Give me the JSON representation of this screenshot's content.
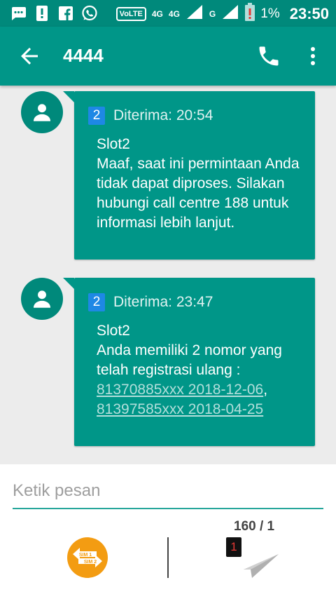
{
  "status_bar": {
    "network_labels": [
      "4G",
      "4G",
      "G"
    ],
    "volte": "VoLTE",
    "battery": "1%",
    "time": "23:50",
    "icons": [
      "message-icon",
      "alert-icon",
      "facebook-icon",
      "whatsapp-icon",
      "signal-icon",
      "battery-low-icon"
    ]
  },
  "toolbar": {
    "title": "4444",
    "back_icon": "arrow-back-icon",
    "call_icon": "phone-icon",
    "menu_icon": "more-vert-icon"
  },
  "messages": [
    {
      "sim": "2",
      "received_label": "Diterima: 20:54",
      "lines": [
        "Slot2",
        "Maaf, saat ini permintaan Anda tidak dapat diproses. Silakan hubungi call centre 188 untuk informasi lebih lanjut."
      ]
    },
    {
      "sim": "2",
      "received_label": "Diterima: 23:47",
      "slot": "Slot2",
      "text_prefix": "Anda memiliki 2 nomor yang telah registrasi ulang : ",
      "link1": "81370885xxx 2018-12-06",
      "separator": ", ",
      "link2": "81397585xxx 2018-04-25"
    }
  ],
  "compose": {
    "placeholder": "Ketik pesan",
    "counter": "160 / 1",
    "sim_switch_labels": [
      "SIM 1",
      "SIM 2"
    ],
    "send_sim_badge": "1"
  },
  "colors": {
    "primary": "#009688",
    "primary_dark": "#00897b",
    "accent": "#26a69a",
    "sim_badge": "#1e88e5",
    "sim_switch": "#f39c12"
  }
}
